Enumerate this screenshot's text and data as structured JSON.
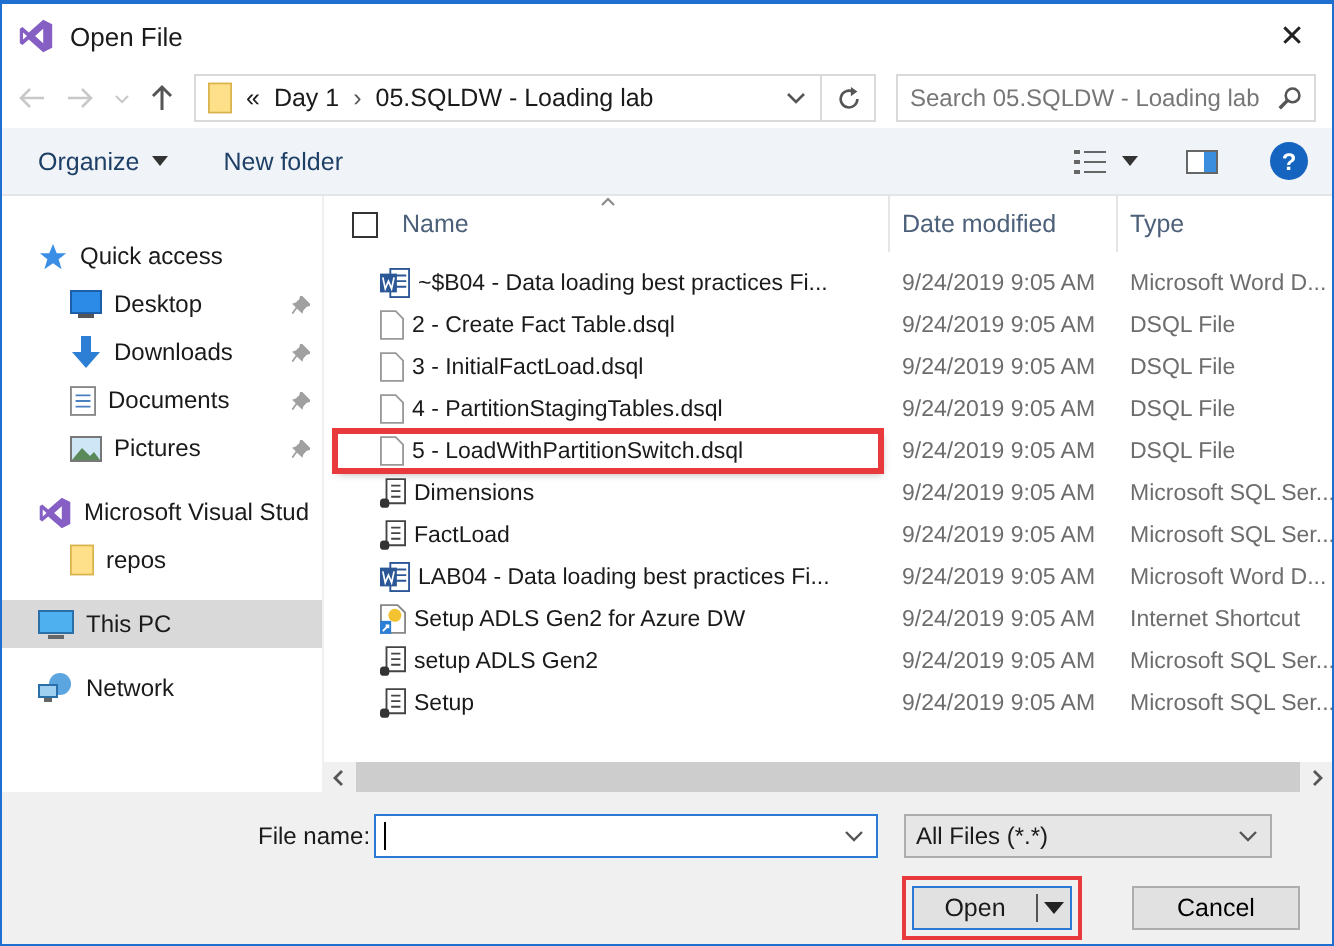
{
  "window": {
    "title": "Open File",
    "close": "✕"
  },
  "nav": {
    "path_prefix": "«",
    "breadcrumbs": [
      "Day 1",
      "05.SQLDW - Loading lab"
    ],
    "separator": "›",
    "search": {
      "placeholder": "Search 05.SQLDW - Loading lab"
    }
  },
  "toolbar": {
    "organize": "Organize",
    "new_folder": "New folder",
    "help": "?"
  },
  "sidebar": {
    "groups": [
      {
        "items": [
          {
            "label": "Quick access",
            "kind": "star",
            "pinned": false,
            "selected": false
          },
          {
            "label": "Desktop",
            "kind": "desktop",
            "pinned": true,
            "selected": false
          },
          {
            "label": "Downloads",
            "kind": "download",
            "pinned": true,
            "selected": false
          },
          {
            "label": "Documents",
            "kind": "documents",
            "pinned": true,
            "selected": false
          },
          {
            "label": "Pictures",
            "kind": "pictures",
            "pinned": true,
            "selected": false
          }
        ]
      },
      {
        "items": [
          {
            "label": "Microsoft Visual Stud",
            "kind": "vs",
            "pinned": false,
            "selected": false
          },
          {
            "label": "repos",
            "kind": "folder",
            "pinned": false,
            "selected": false
          }
        ]
      },
      {
        "items": [
          {
            "label": "This PC",
            "kind": "pc",
            "pinned": false,
            "selected": true
          }
        ]
      },
      {
        "items": [
          {
            "label": "Network",
            "kind": "network",
            "pinned": false,
            "selected": false
          }
        ]
      }
    ]
  },
  "table": {
    "select_all_checked": false,
    "columns": [
      "Name",
      "Date modified",
      "Type"
    ],
    "rows": [
      {
        "name": "~$B04 - Data loading best practices Fi...",
        "date": "9/24/2019 9:05 AM",
        "type": "Microsoft Word D...",
        "kind": "word",
        "highlighted": false
      },
      {
        "name": "2 - Create Fact Table.dsql",
        "date": "9/24/2019 9:05 AM",
        "type": "DSQL File",
        "kind": "file",
        "highlighted": false
      },
      {
        "name": "3 - InitialFactLoad.dsql",
        "date": "9/24/2019 9:05 AM",
        "type": "DSQL File",
        "kind": "file",
        "highlighted": false
      },
      {
        "name": "4 - PartitionStagingTables.dsql",
        "date": "9/24/2019 9:05 AM",
        "type": "DSQL File",
        "kind": "file",
        "highlighted": false
      },
      {
        "name": "5 - LoadWithPartitionSwitch.dsql",
        "date": "9/24/2019 9:05 AM",
        "type": "DSQL File",
        "kind": "file",
        "highlighted": true
      },
      {
        "name": "Dimensions",
        "date": "9/24/2019 9:05 AM",
        "type": "Microsoft SQL Ser...",
        "kind": "sql",
        "highlighted": false
      },
      {
        "name": "FactLoad",
        "date": "9/24/2019 9:05 AM",
        "type": "Microsoft SQL Ser...",
        "kind": "sql",
        "highlighted": false
      },
      {
        "name": "LAB04 - Data loading best practices Fi...",
        "date": "9/24/2019 9:05 AM",
        "type": "Microsoft Word D...",
        "kind": "word",
        "highlighted": false
      },
      {
        "name": "Setup ADLS Gen2 for Azure DW",
        "date": "9/24/2019 9:05 AM",
        "type": "Internet Shortcut",
        "kind": "shortcut",
        "highlighted": false
      },
      {
        "name": "setup ADLS Gen2",
        "date": "9/24/2019 9:05 AM",
        "type": "Microsoft SQL Ser...",
        "kind": "sql",
        "highlighted": false
      },
      {
        "name": "Setup",
        "date": "9/24/2019 9:05 AM",
        "type": "Microsoft SQL Ser...",
        "kind": "sql",
        "highlighted": false
      }
    ]
  },
  "footer": {
    "file_name_label": "File name:",
    "file_type": "All Files (*.*)",
    "open": {
      "label": "Open",
      "highlighted": true
    },
    "cancel": "Cancel"
  }
}
